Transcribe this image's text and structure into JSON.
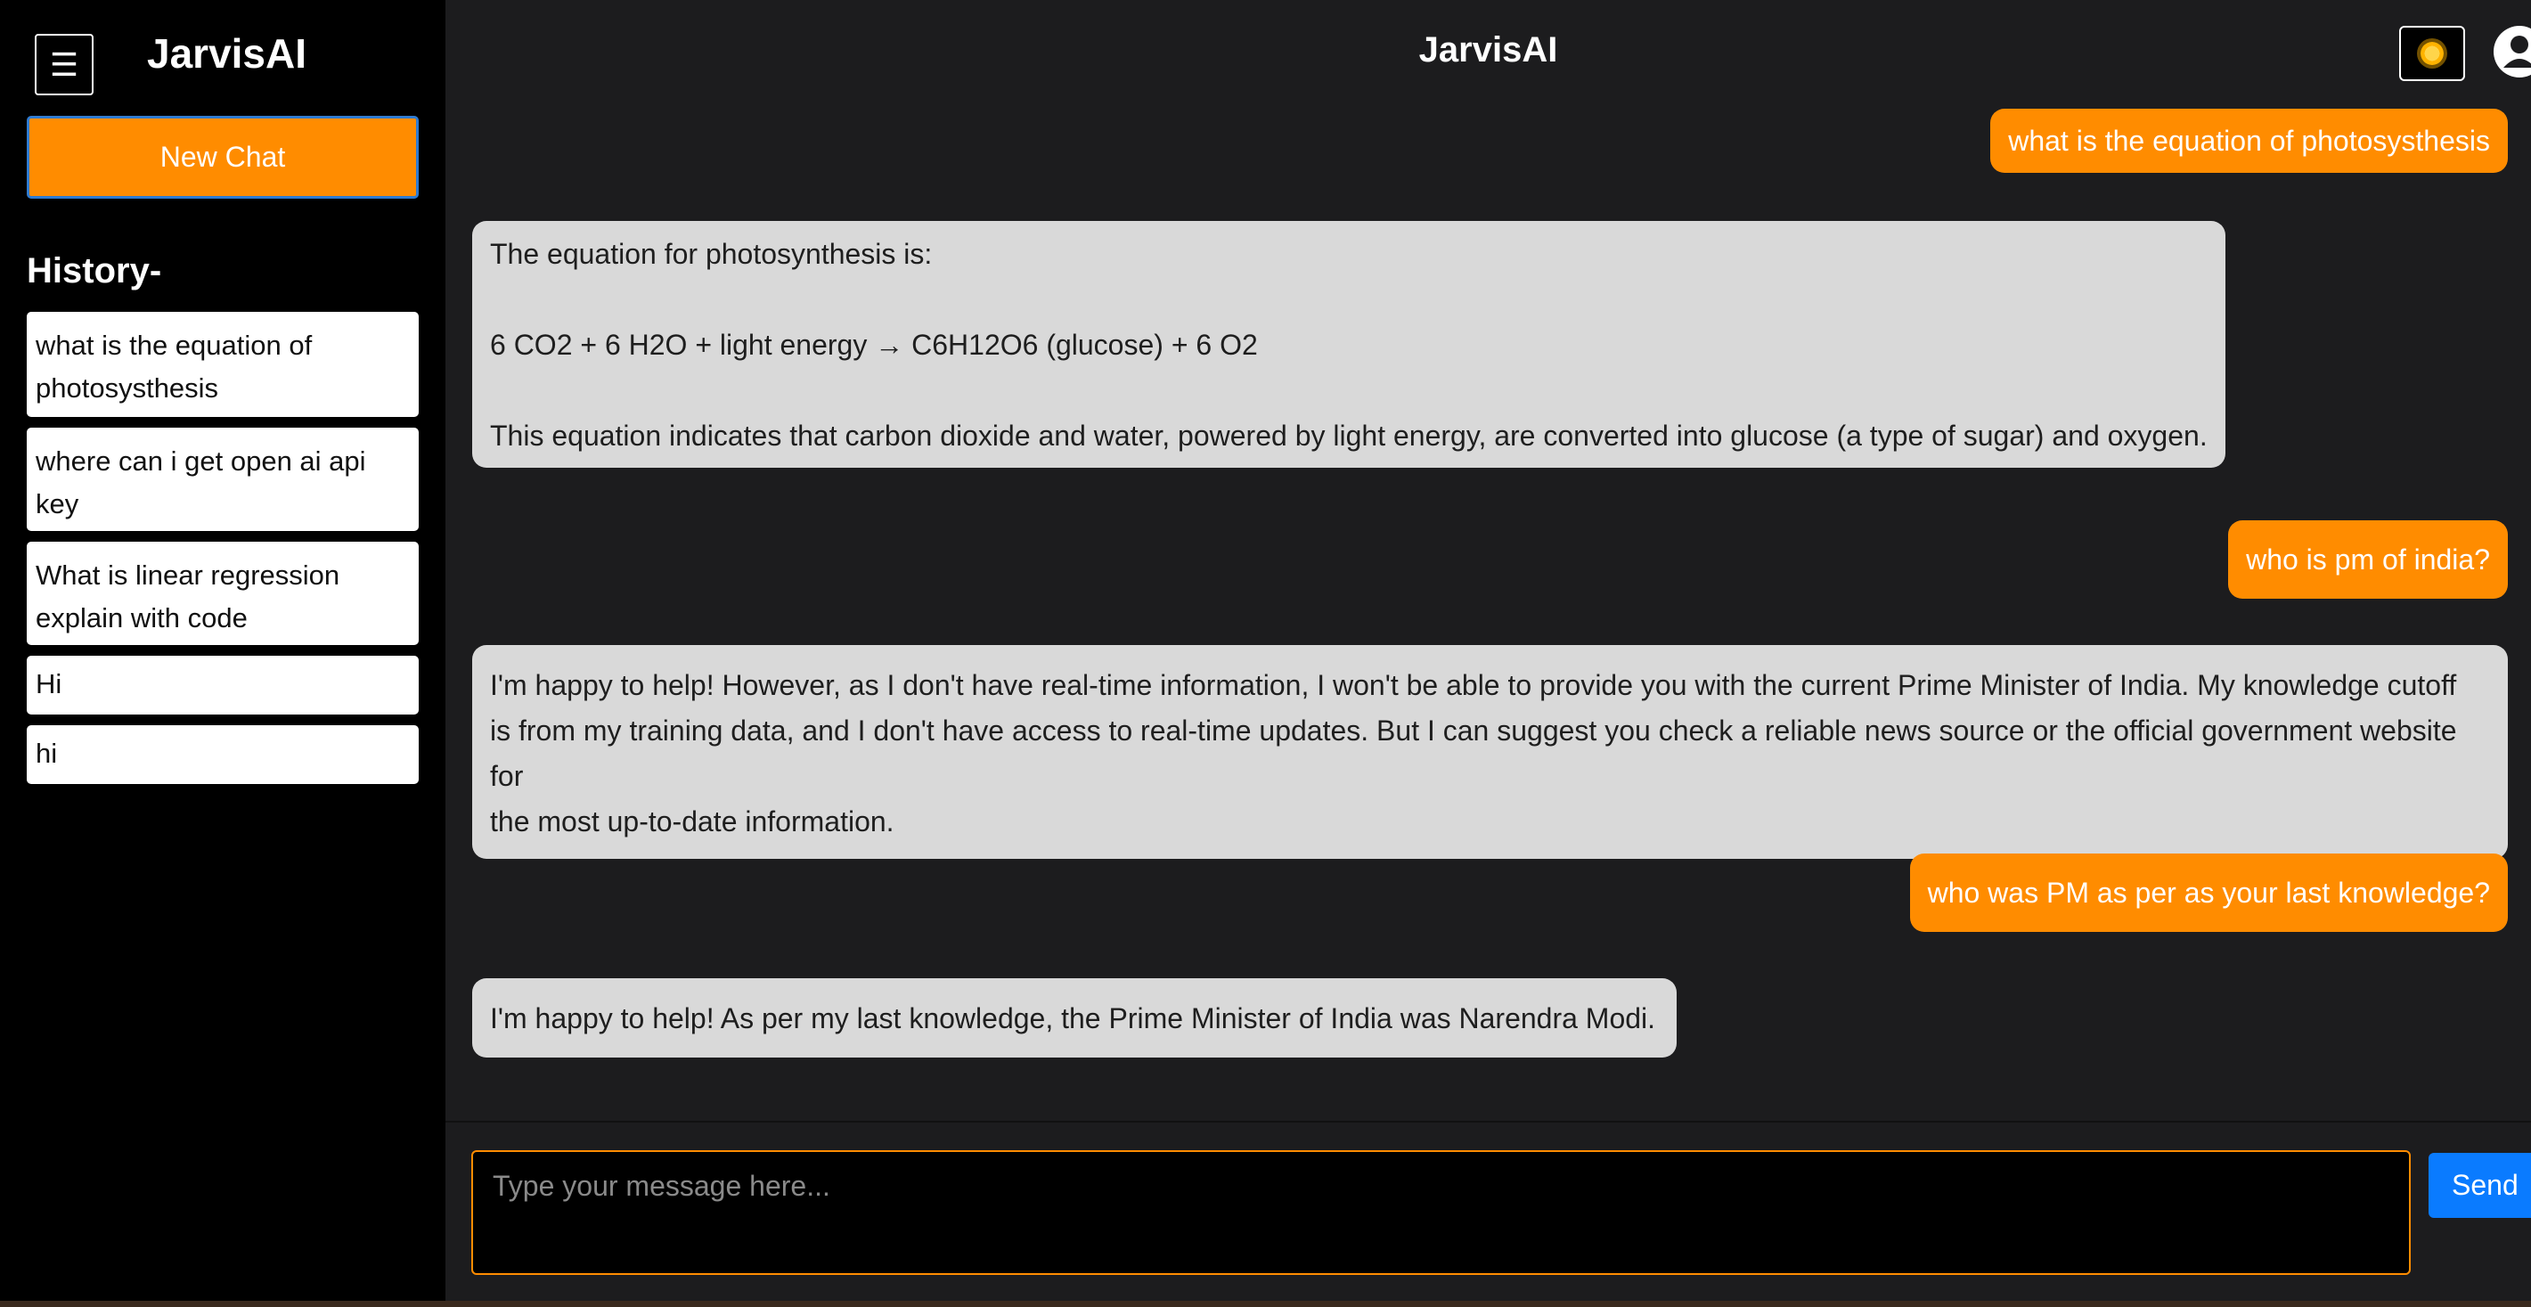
{
  "sidebar": {
    "menu_icon": "hamburger-icon",
    "brand": "JarvisAI",
    "new_chat_label": "New Chat",
    "history_title": "History-",
    "history": [
      "what is the equation of photosysthesis",
      "where can i get open ai api key",
      "What is linear regression explain with code",
      "Hi",
      "hi"
    ]
  },
  "header": {
    "title": "JarvisAI",
    "theme_icon": "sun-icon",
    "user_icon": "user-avatar-icon"
  },
  "messages": [
    {
      "role": "user",
      "text": "what is the equation of photosysthesis"
    },
    {
      "role": "bot",
      "lines": [
        "The equation for photosynthesis is:",
        "",
        "6 CO2 + 6 H2O + light energy → C6H12O6 (glucose) + 6 O2",
        "",
        "This equation indicates that carbon dioxide and water, powered by light energy, are converted into glucose (a type of sugar) and oxygen."
      ]
    },
    {
      "role": "user",
      "text": "who is pm of india?"
    },
    {
      "role": "bot",
      "lines": [
        "I'm happy to help! However, as I don't have real-time information, I won't be able to provide you with the current Prime Minister of India. My knowledge cutoff",
        "is from my training data, and I don't have access to real-time updates. But I can suggest you check a reliable news source or the official government website for",
        "the most up-to-date information."
      ]
    },
    {
      "role": "user",
      "text": "who was PM as per as your last knowledge?"
    },
    {
      "role": "bot",
      "lines": [
        "I'm happy to help! As per my last knowledge, the Prime Minister of India was Narendra Modi."
      ]
    }
  ],
  "composer": {
    "placeholder": "Type your message here...",
    "send_label": "Send"
  },
  "colors": {
    "accent": "#ff8c00",
    "send": "#0a7bff",
    "bot_bubble": "#d9d9d9",
    "background": "#1c1c1e"
  }
}
